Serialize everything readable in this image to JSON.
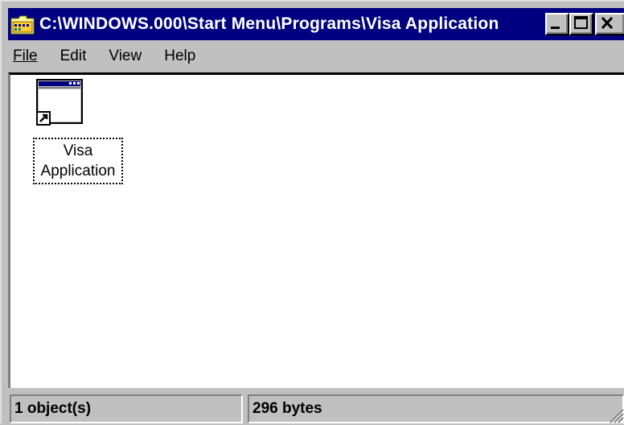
{
  "window": {
    "title": "C:\\WINDOWS.000\\Start Menu\\Programs\\Visa Application",
    "title_icon": "folder-icon",
    "controls": [
      "minimize-icon",
      "maximize-icon",
      "close-icon"
    ]
  },
  "menu": {
    "file": "File",
    "edit": "Edit",
    "view": "View",
    "help": "Help"
  },
  "content": {
    "items": [
      {
        "label_line1": "Visa",
        "label_line2": "Application",
        "icon": "shortcut-window-icon"
      }
    ]
  },
  "status": {
    "objects": "1 object(s)",
    "size": "296 bytes"
  },
  "colors": {
    "titlebar": "#000080",
    "face": "#c0c0c0",
    "content_bg": "#ffffff"
  }
}
